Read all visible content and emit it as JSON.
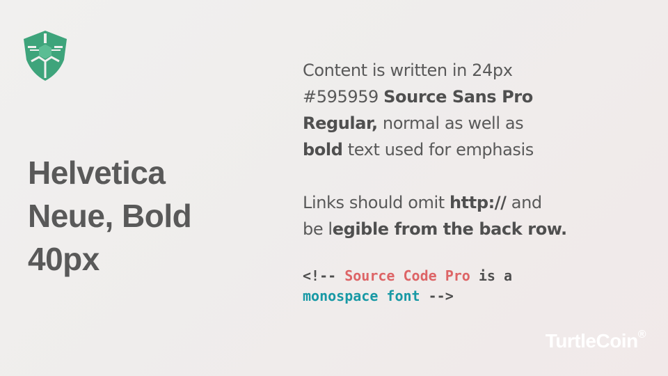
{
  "logo": {
    "icon": "turtle-shell-shield-icon",
    "color": "#3ea47b"
  },
  "headline": {
    "lines": [
      "Helvetica",
      "Neue, Bold",
      "40px"
    ],
    "color": "#595959"
  },
  "content": {
    "p1": {
      "l1": "Content is written in 24px",
      "l2_plain": "#595959 ",
      "l2_bold": "Source Sans Pro",
      "l3_bold": "Regular,",
      "l3_plain": " normal as well as",
      "l4_bold": "bold",
      "l4_plain": " text used for emphasis"
    },
    "p2": {
      "l1_plain": "Links should omit ",
      "l1_bold": "http://",
      "l1_end": " and",
      "l2_plain": "be l",
      "l2_bold": "egible from the back row."
    },
    "color": "#595959"
  },
  "code": {
    "l1_start": "<!-- ",
    "l1_red": "Source Code Pro",
    "l1_end": " is a",
    "l2_teal": "monospace font",
    "l2_end": " -->",
    "colors": {
      "text": "#4e4e4e",
      "red": "#dd6466",
      "teal": "#1899a5"
    }
  },
  "brand": {
    "name": "TurtleCoin",
    "mark": "®"
  }
}
